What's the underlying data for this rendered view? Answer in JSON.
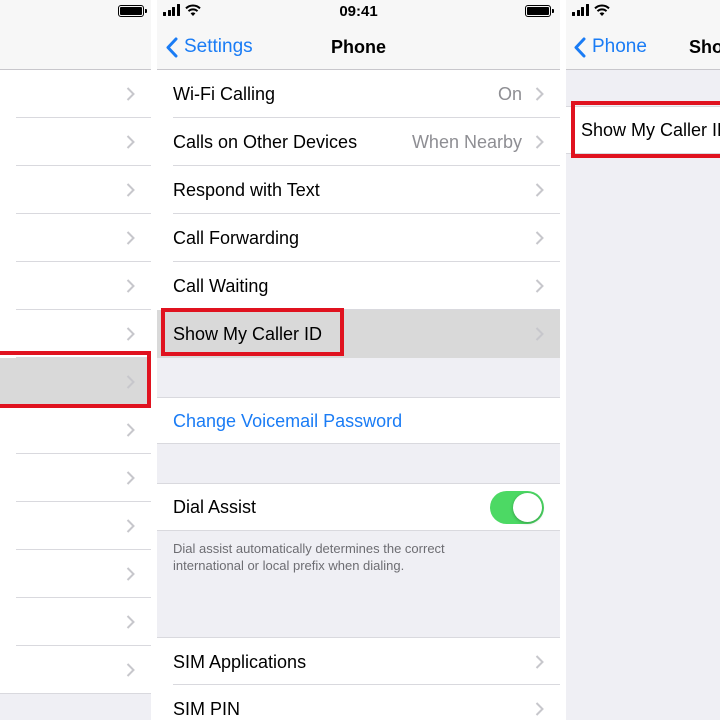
{
  "status": {
    "time": "09:41"
  },
  "left_panel": {
    "rows": [
      "",
      "",
      "",
      "",
      "",
      "",
      "",
      "",
      "",
      "",
      "",
      "",
      ""
    ],
    "highlighted_row_index": 6
  },
  "mid_panel": {
    "nav": {
      "back_label": "Settings",
      "title": "Phone"
    },
    "rows": [
      {
        "label": "Wi-Fi Calling",
        "detail": "On"
      },
      {
        "label": "Calls on Other Devices",
        "detail": "When Nearby"
      },
      {
        "label": "Respond with Text",
        "detail": ""
      },
      {
        "label": "Call Forwarding",
        "detail": ""
      },
      {
        "label": "Call Waiting",
        "detail": ""
      },
      {
        "label": "Show My Caller ID",
        "detail": ""
      }
    ],
    "voicemail_link": "Change Voicemail Password",
    "dial_assist": {
      "label": "Dial Assist",
      "enabled": true,
      "footnote_line1": "Dial assist automatically determines the correct",
      "footnote_line2": "international or local prefix when dialing."
    },
    "bottom_rows": [
      {
        "label": "SIM Applications"
      },
      {
        "label": "SIM PIN"
      }
    ]
  },
  "right_panel": {
    "nav": {
      "back_label": "Phone",
      "title": "Sho"
    },
    "row_label": "Show My Caller ID"
  },
  "colors": {
    "accent": "#1a7cf5",
    "highlight_box": "#e0121f",
    "toggle_on": "#4cd964"
  }
}
